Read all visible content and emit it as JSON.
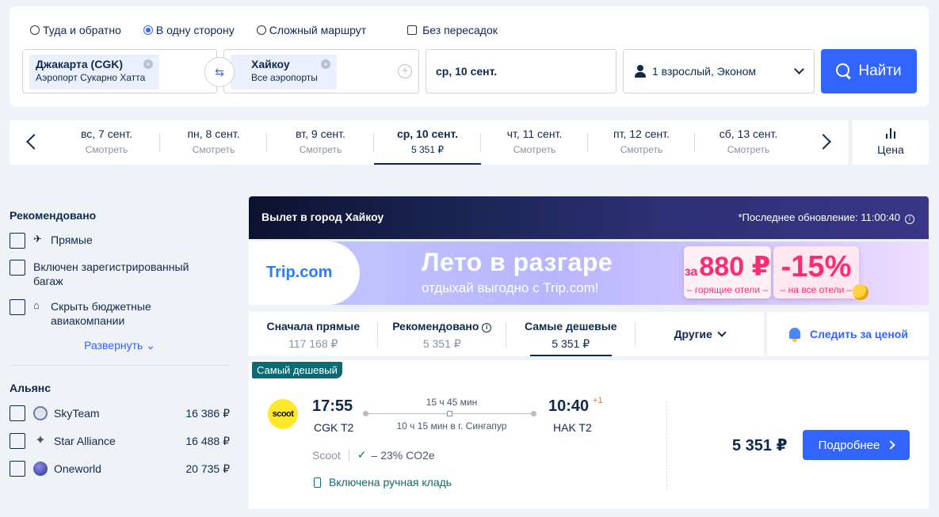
{
  "search": {
    "trip_types": [
      {
        "label": "Туда и обратно",
        "selected": false
      },
      {
        "label": "В одну сторону",
        "selected": true
      },
      {
        "label": "Сложный маршрут",
        "selected": false
      }
    ],
    "nonstop_label": "Без пересадок",
    "from": {
      "city": "Джакарта (CGK)",
      "airport": "Аэропорт Сукарно Хатта"
    },
    "to": {
      "city": "Хайкоу",
      "airport": "Все аэропорты"
    },
    "date": "ср, 10 сент.",
    "passengers": "1 взрослый, Эконом",
    "search_button": "Найти"
  },
  "date_strip": {
    "dates": [
      {
        "day": "вс, 7 сент.",
        "price": "Смотреть",
        "active": false
      },
      {
        "day": "пн, 8 сент.",
        "price": "Смотреть",
        "active": false
      },
      {
        "day": "вт, 9 сент.",
        "price": "Смотреть",
        "active": false
      },
      {
        "day": "ср, 10 сент.",
        "price": "5 351 ₽",
        "active": true
      },
      {
        "day": "чт, 11 сент.",
        "price": "Смотреть",
        "active": false
      },
      {
        "day": "пт, 12 сент.",
        "price": "Смотреть",
        "active": false
      },
      {
        "day": "сб, 13 сент.",
        "price": "Смотреть",
        "active": false
      }
    ],
    "price_label": "Цена"
  },
  "sidebar": {
    "recommended_title": "Рекомендовано",
    "recommended_items": [
      {
        "label": "Прямые",
        "icon": "plane-takeoff-icon"
      },
      {
        "label": "Включен зарегистрированный багаж",
        "icon": ""
      },
      {
        "label": "Скрыть бюджетные авиакомпании",
        "icon": "tag-icon"
      }
    ],
    "expand_label": "Развернуть",
    "alliance_title": "Альянс",
    "alliances": [
      {
        "name": "SkyTeam",
        "price": "16 386 ₽",
        "icon_color": "#6b7aa8"
      },
      {
        "name": "Star Alliance",
        "price": "16 488 ₽",
        "icon_color": "#555555"
      },
      {
        "name": "Oneworld",
        "price": "20 735 ₽",
        "icon_color": "#2c2f8a"
      }
    ]
  },
  "results": {
    "header_title": "Вылет в город Хайкоу",
    "last_update": "*Последнее обновление: 11:00:40",
    "promo": {
      "logo": "Trip.com",
      "headline": "Лето в разгаре",
      "subline": "отдыхай выгодно с Trip.com!",
      "badge1_prefix": "за",
      "badge1_value": "880 ₽",
      "badge1_caption": "– горящие отели –",
      "badge2_value": "-15%",
      "badge2_caption": "– на все отели –"
    },
    "sort": [
      {
        "label": "Сначала прямые",
        "value": "117 168 ₽",
        "active": false
      },
      {
        "label": "Рекомендовано",
        "value": "5 351 ₽",
        "active": false
      },
      {
        "label": "Самые дешевые",
        "value": "5 351 ₽",
        "active": true
      }
    ],
    "other_label": "Другие",
    "watch_label": "Следить за ценой",
    "flight": {
      "tag": "Самый дешевый",
      "airline_logo": "scoot",
      "dep_time": "17:55",
      "dep_code": "CGK T2",
      "duration": "15 ч 45 мин",
      "stop_info": "10 ч 15 мин в г. Сингапур",
      "arr_time": "10:40",
      "arr_plus": "+1",
      "arr_code": "HAK T2",
      "airline": "Scoot",
      "co2": "– 23% CO2e",
      "baggage": "Включена ручная кладь",
      "price": "5 351 ₽",
      "details_button": "Подробнее"
    }
  }
}
